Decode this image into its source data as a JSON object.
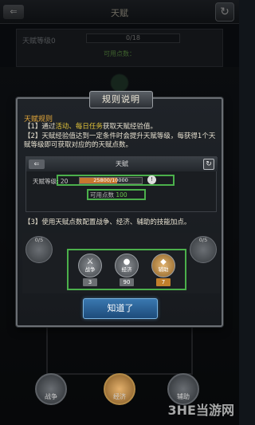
{
  "background": {
    "title": "天赋",
    "back_icon": "back-arrow-icon",
    "refresh_icon": "refresh-icon",
    "level_label": "天赋等级0",
    "level_value": "0/18",
    "points_label": "可用点数：",
    "bottom_nodes": [
      "战争",
      "经济",
      "辅助"
    ]
  },
  "dialog": {
    "title": "规则说明",
    "heading": "天赋规则",
    "rule1_prefix": "【1】通过",
    "rule1_highlight": "活动、每日任务",
    "rule1_suffix": "获取天赋经验值。",
    "rule2": "【2】天赋经验值达到一定条件时会提升天赋等级，每获得1个天赋等级即可获取对应的的天赋点数。",
    "rule3": "【3】使用天赋点数配置战争、经济、辅助的技能加点。",
    "preview": {
      "title": "天赋",
      "level_label": "天赋等级: 20",
      "exp_text": "25800/10000",
      "exp_fraction": 0.6,
      "points_label": "可用点数",
      "points_value": "100",
      "info_icon": "info-icon"
    },
    "skills": [
      {
        "name": "战争",
        "count": "3",
        "icon": "sword-icon",
        "style": "gray"
      },
      {
        "name": "经济",
        "count": "90",
        "icon": "money-bag-icon",
        "style": "gray"
      },
      {
        "name": "辅助",
        "count": "7",
        "icon": "shield-icon",
        "style": "orange"
      }
    ],
    "side_nodes": [
      "0/5",
      "0/5"
    ],
    "ok_button": "知道了"
  },
  "watermark": "3HE当游网"
}
